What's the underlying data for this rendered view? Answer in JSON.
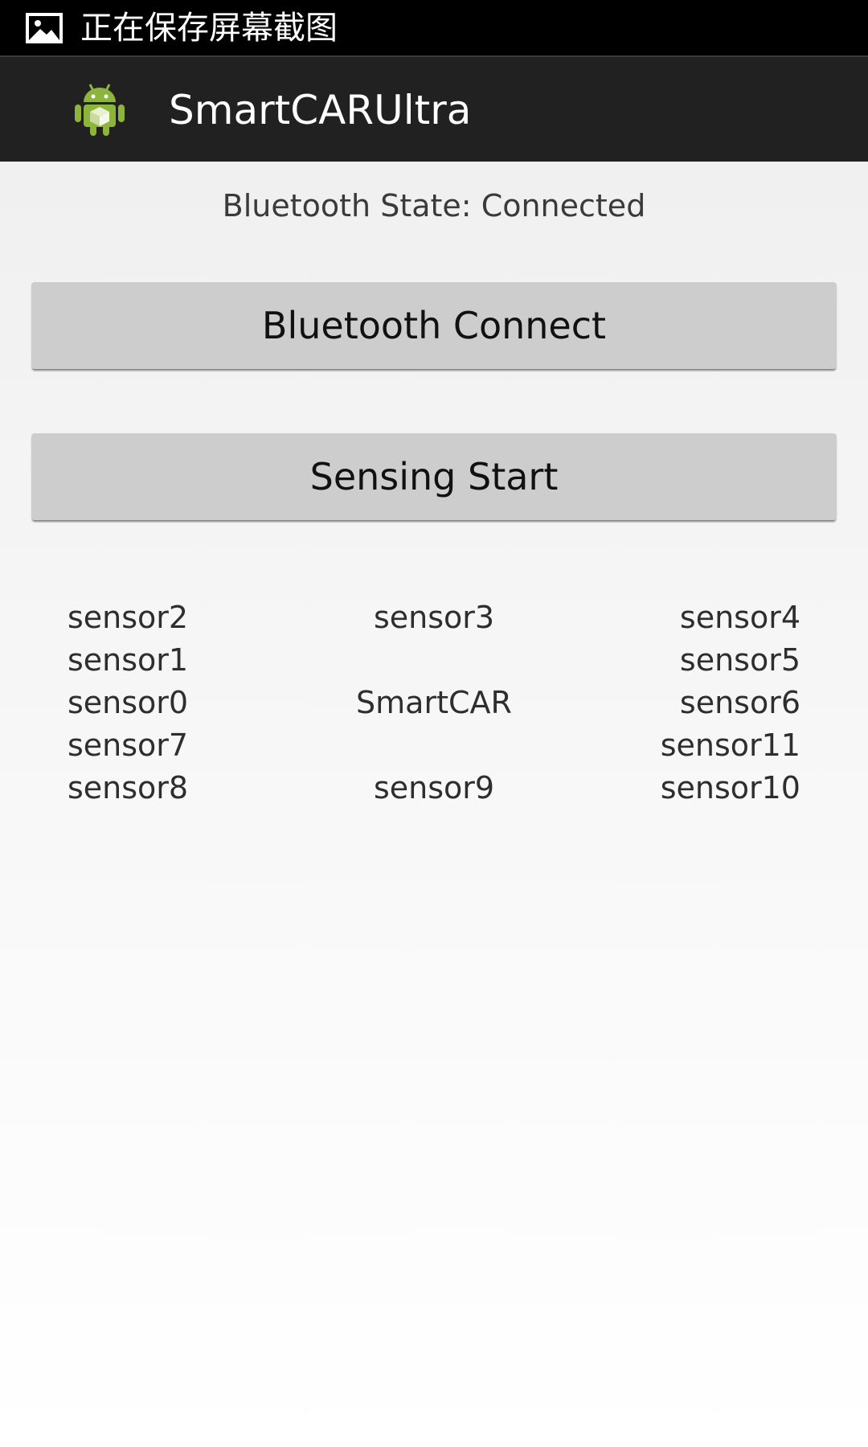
{
  "status_bar": {
    "icon": "image-icon",
    "text": "正在保存屏幕截图"
  },
  "action_bar": {
    "icon": "android-icon",
    "title": "SmartCARUltra"
  },
  "main": {
    "bluetooth_state": "Bluetooth State: Connected",
    "connect_button": "Bluetooth Connect",
    "sensing_button": "Sensing Start",
    "sensor_rows": [
      {
        "left": "sensor2",
        "center": "sensor3",
        "right": "sensor4"
      },
      {
        "left": "sensor1",
        "center": "",
        "right": "sensor5"
      },
      {
        "left": "sensor0",
        "center": "SmartCAR",
        "right": "sensor6"
      },
      {
        "left": "sensor7",
        "center": "",
        "right": "sensor11"
      },
      {
        "left": "sensor8",
        "center": "sensor9",
        "right": "sensor10"
      }
    ]
  },
  "colors": {
    "status_bar_bg": "#000000",
    "action_bar_bg": "#212121",
    "button_bg": "#cdcdcd",
    "android_green": "#8db53b"
  }
}
